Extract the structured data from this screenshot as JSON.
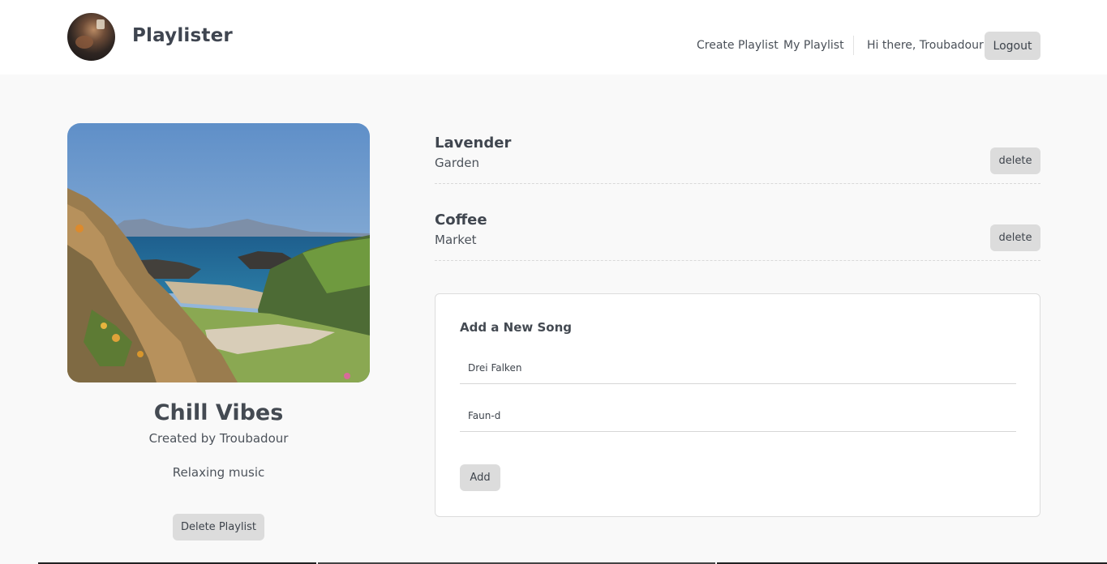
{
  "header": {
    "app_name": "Playlister",
    "nav": {
      "create_playlist": "Create Playlist",
      "my_playlist": "My Playlist",
      "greeting": "Hi there, Troubadour",
      "logout": "Logout"
    }
  },
  "playlist": {
    "title": "Chill Vibes",
    "creator": "Created by Troubadour",
    "description": "Relaxing music",
    "delete_label": "Delete Playlist"
  },
  "songs": [
    {
      "title": "Lavender",
      "artist": "Garden",
      "delete_label": "delete"
    },
    {
      "title": "Coffee",
      "artist": "Market",
      "delete_label": "delete"
    }
  ],
  "add_song": {
    "heading": "Add a New Song",
    "title_value": "Drei Falken",
    "artist_value": "Faun-d",
    "submit_label": "Add"
  },
  "colors": {
    "header_bg": "#ffffff",
    "page_bg": "#f9f9f9",
    "button_bg": "#dcdcdc",
    "text": "#444a52"
  }
}
